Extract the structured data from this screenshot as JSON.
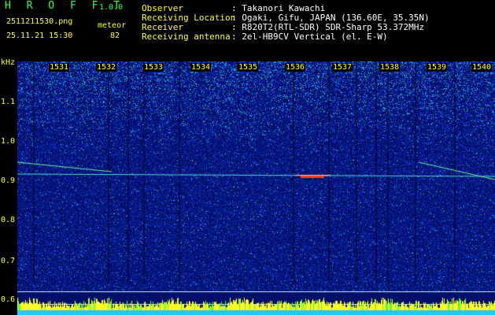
{
  "header": {
    "logo": "H R O F F T",
    "version": "1.0.0",
    "filename": "2511211530.png",
    "datetime": "25.11.21 15:30",
    "meteor_label": "meteor",
    "meteor_count": "82",
    "info": [
      {
        "label": "Observer",
        "value": ": Takanori Kawachi"
      },
      {
        "label": "Receiving Location",
        "value": ": Ogaki, Gifu, JAPAN (136.60E, 35.35N)"
      },
      {
        "label": "Receiver",
        "value": ": R820T2(RTL-SDR) SDR-Sharp 53.372MHz"
      },
      {
        "label": "Receiving antenna",
        "value": ": 2el-HB9CV Vertical (el. E-W)"
      }
    ]
  },
  "axis": {
    "unit": "kHz",
    "y_ticks": [
      "1.1",
      "1.0",
      "0.9",
      "0.8",
      "0.7",
      "0.6"
    ],
    "x_ticks": [
      "1531",
      "1532",
      "1533",
      "1534",
      "1535",
      "1536",
      "1537",
      "1538",
      "1539",
      "1540"
    ]
  },
  "colors": {
    "label": "#ffff33",
    "logo": "#3aff3a",
    "background": "#000000"
  }
}
